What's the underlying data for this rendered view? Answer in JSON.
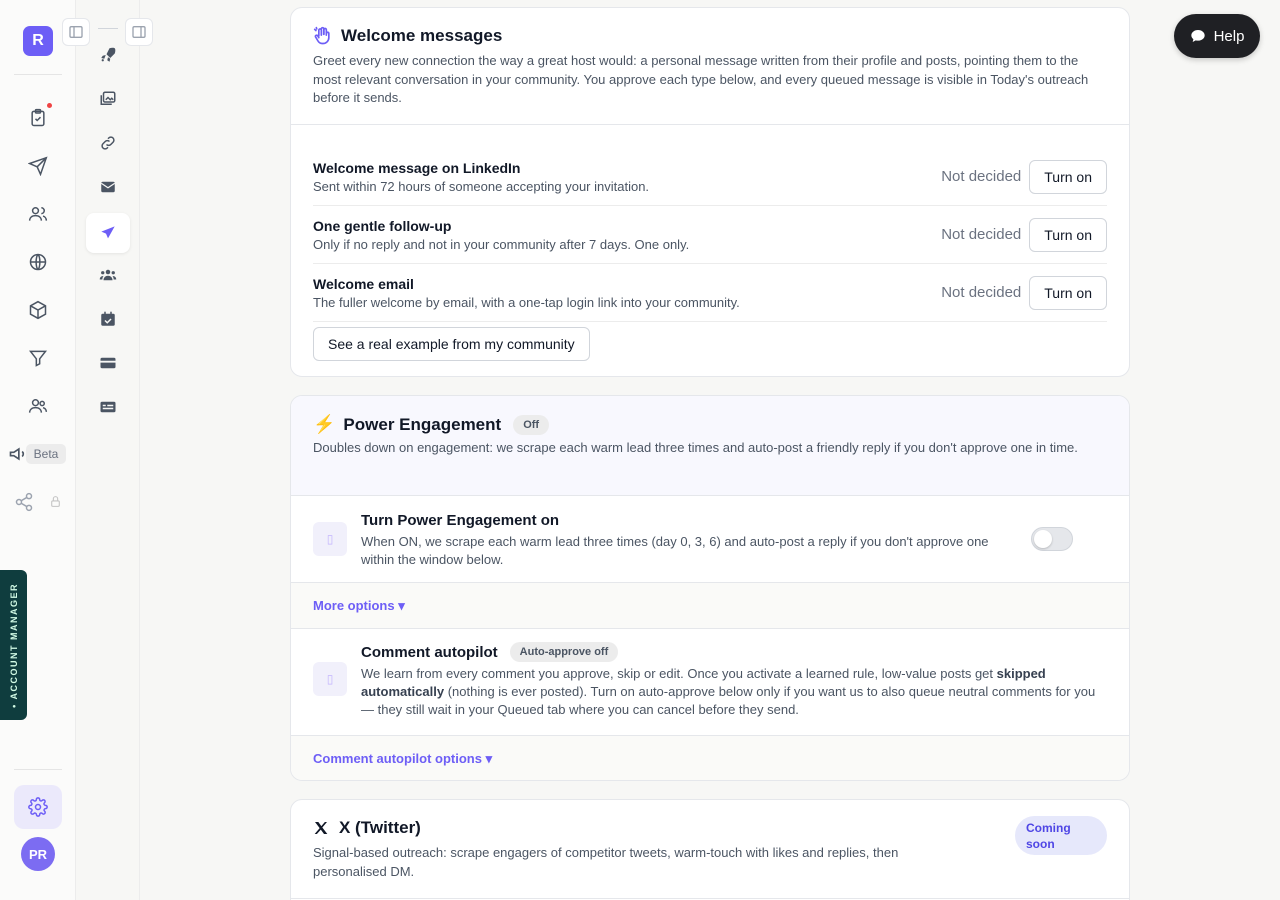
{
  "rail": {
    "logo_letter": "R",
    "beta_label": "Beta",
    "avatar_initials": "PR",
    "account_manager_label": "• ACCOUNT MANAGER"
  },
  "help": {
    "label": "Help"
  },
  "welcome": {
    "title": "Welcome messages",
    "description": "Greet every new connection the way a great host would: a personal message written from their profile and posts, pointing them to the most relevant conversation in your community. You approve each type below, and every queued message is visible in Today's outreach before it sends.",
    "rows": [
      {
        "title": "Welcome message on LinkedIn",
        "desc": "Sent within 72 hours of someone accepting your invitation.",
        "status": "Not decided",
        "button": "Turn on"
      },
      {
        "title": "One gentle follow-up",
        "desc": "Only if no reply and not in your community after 7 days. One only.",
        "status": "Not decided",
        "button": "Turn on"
      },
      {
        "title": "Welcome email",
        "desc": "The fuller welcome by email, with a one-tap login link into your community.",
        "status": "Not decided",
        "button": "Turn on"
      }
    ],
    "example_button": "See a real example from my community"
  },
  "power": {
    "icon": "⚡",
    "title": "Power Engagement",
    "badge": "Off",
    "description": "Doubles down on engagement: we scrape each warm lead three times and auto-post a friendly reply if you don't approve one in time.",
    "toggle": {
      "title": "Turn Power Engagement on",
      "desc": "When ON, we scrape each warm lead three times (day 0, 3, 6) and auto-post a reply if you don't approve one within the window below.",
      "enabled": false
    },
    "more_options": "More options ▾",
    "autopilot": {
      "title": "Comment autopilot",
      "badge": "Auto-approve off",
      "desc_before": "We learn from every comment you approve, skip or edit. Once you activate a learned rule, low-value posts get ",
      "desc_bold": "skipped automatically",
      "desc_after": " (nothing is ever posted). Turn on auto-approve below only if you want us to also queue neutral comments for you — they still wait in your Queued tab where you can cancel before they send."
    },
    "autopilot_options": "Comment autopilot options ▾"
  },
  "twitter": {
    "title": "X (Twitter)",
    "badge": "Coming soon",
    "description": "Signal-based outreach: scrape engagers of competitor tweets, warm-touch with likes and replies, then personalised DM."
  },
  "colors": {
    "accent": "#6d5ef6",
    "dark": "#1f2024",
    "account_manager_bg": "#0f3d3e"
  }
}
